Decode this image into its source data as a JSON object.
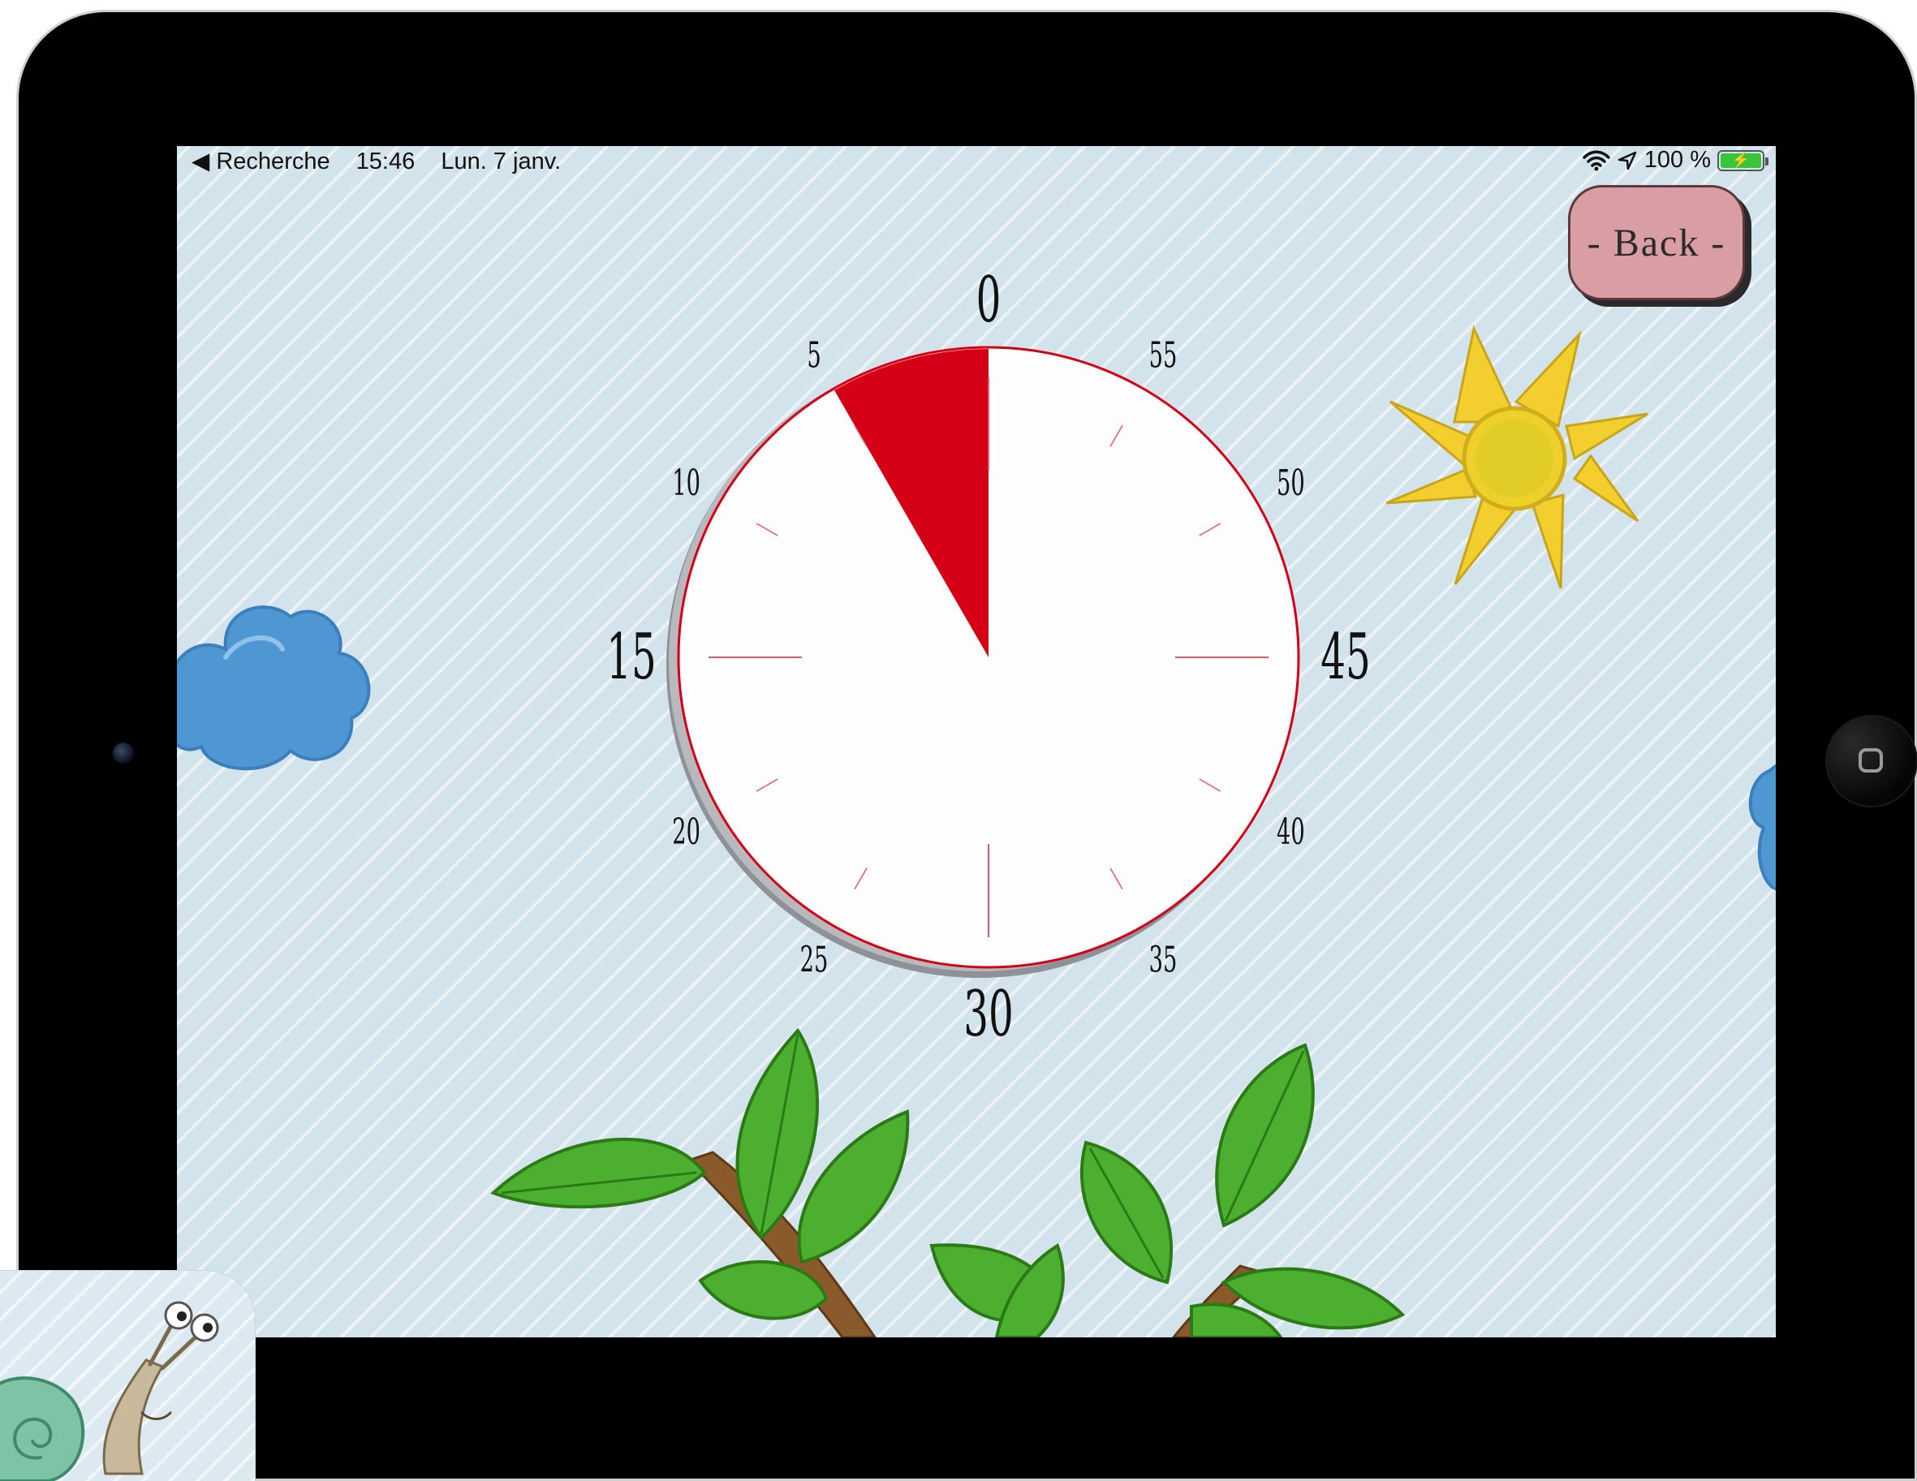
{
  "status_bar": {
    "back_app": "◀ Recherche",
    "time": "15:46",
    "date": "Lun. 7 janv.",
    "battery_percent": "100 %",
    "battery_level": 1.0
  },
  "toolbar": {
    "back_label": "- Back -"
  },
  "timer": {
    "dial_labels": [
      "0",
      "5",
      "10",
      "15",
      "20",
      "25",
      "30",
      "35",
      "40",
      "45",
      "50",
      "55"
    ],
    "remaining_minutes": 5,
    "dial_max_minutes": 60,
    "colors": {
      "sector": "#d50016",
      "face": "#fdfdfd",
      "rim": "#d50016",
      "shadow": "#8e9197"
    }
  },
  "icons": {
    "wifi": "wifi-icon",
    "location": "location-arrow-icon",
    "battery": "battery-charging-icon",
    "home": "home-button-icon"
  }
}
